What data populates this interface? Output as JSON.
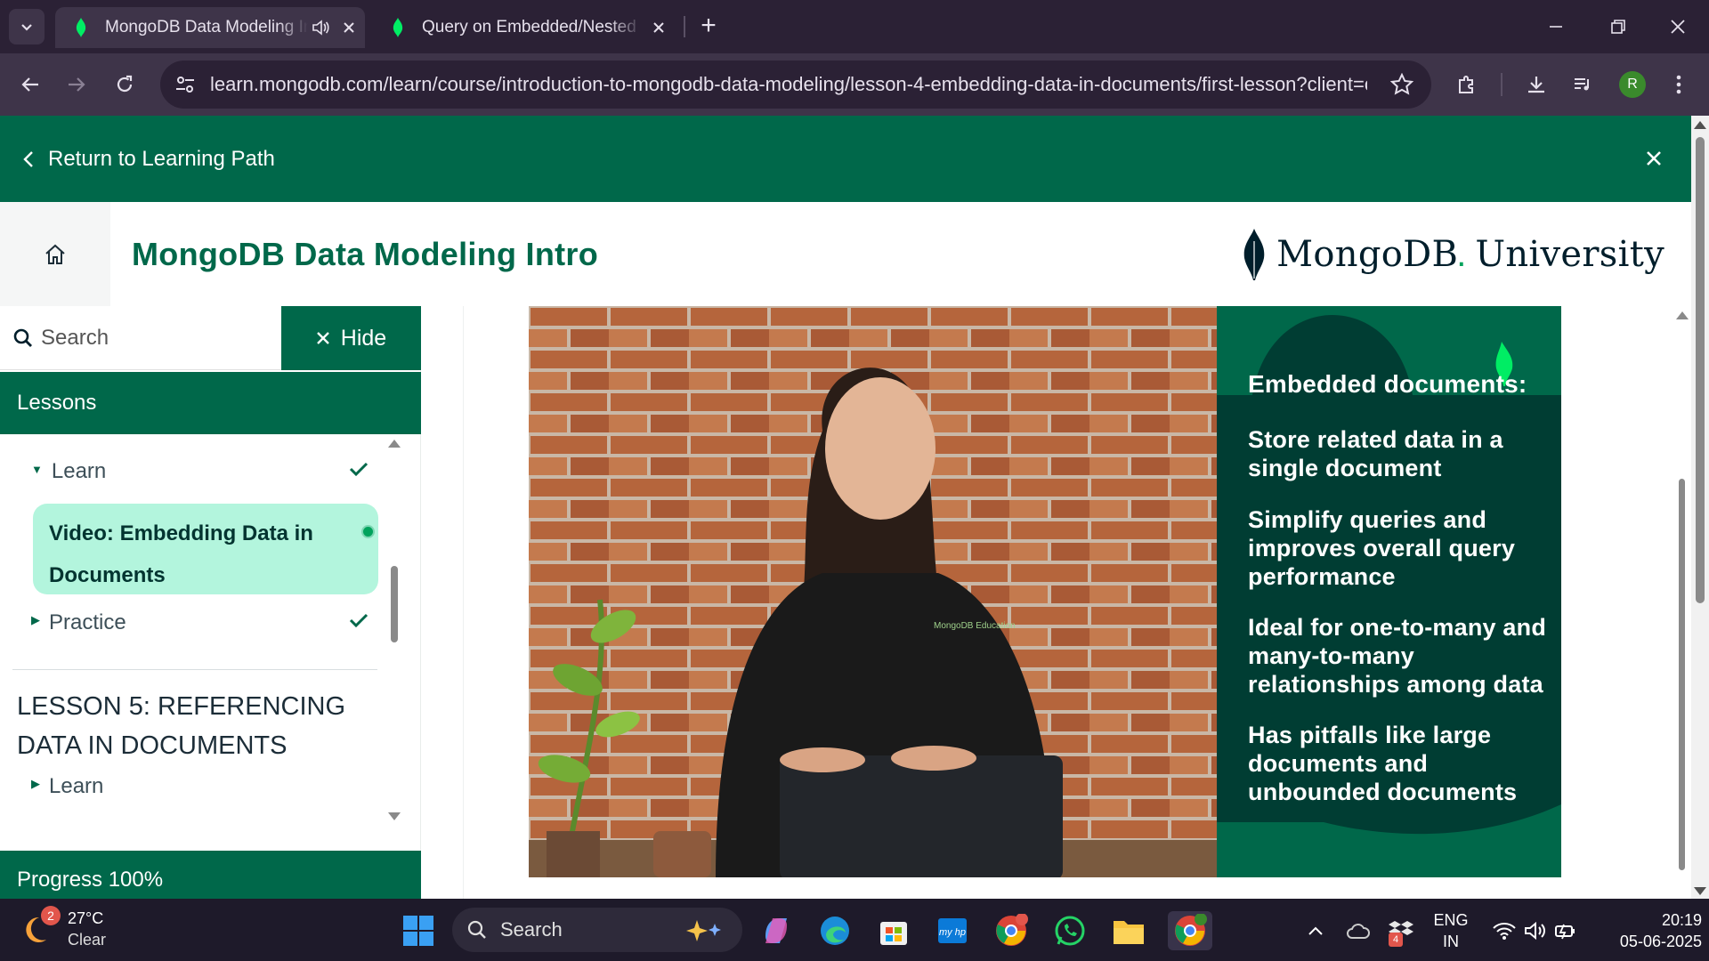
{
  "browser": {
    "tabs": [
      {
        "title": "MongoDB Data Modeling Intro",
        "active": true,
        "audio": true
      },
      {
        "title": "Query on Embedded/Nested Documents",
        "active": false
      }
    ],
    "url": "learn.mongodb.com/learn/course/introduction-to-mongodb-data-modeling/lesson-4-embedding-data-in-documents/first-lesson?client=c...",
    "profile_initial": "R"
  },
  "page": {
    "return_label": "Return to Learning Path",
    "course_title": "MongoDB Data Modeling Intro",
    "logo": {
      "brand": "MongoDB",
      "dot": ".",
      "suffix": "University"
    }
  },
  "sidebar": {
    "search_placeholder": "Search",
    "hide_label": "Hide",
    "lessons_heading": "Lessons",
    "items": [
      {
        "label": "Learn",
        "expanded": true,
        "completed": true
      },
      {
        "label": "Video: Embedding Data in Documents",
        "active": true
      },
      {
        "label": "Practice",
        "expanded": false,
        "completed": true
      }
    ],
    "next_lesson": {
      "title": "LESSON 5: REFERENCING DATA IN DOCUMENTS",
      "items": [
        {
          "label": "Learn"
        }
      ]
    },
    "progress_label": "Progress 100%",
    "progress_value": 100
  },
  "video": {
    "shirt_text": "MongoDB Education",
    "slide": {
      "heading": "Embedded documents:",
      "bullets": [
        "Store related data in a single document",
        "Simplify queries and improves overall query performance",
        "Ideal for one-to-many and many-to-many relationships among data",
        "Has pitfalls like large documents and unbounded documents"
      ]
    }
  },
  "taskbar": {
    "weather": {
      "temp": "27°C",
      "condition": "Clear",
      "badge": "2"
    },
    "search_label": "Search",
    "language": {
      "line1": "ENG",
      "line2": "IN"
    },
    "time": "20:19",
    "date": "05-06-2025",
    "tray_badge": "4"
  },
  "colors": {
    "brand_green": "#00684a",
    "active_item": "#b3f5dd",
    "chrome_dark": "#2b2135",
    "chrome_toolbar": "#3e3449"
  }
}
